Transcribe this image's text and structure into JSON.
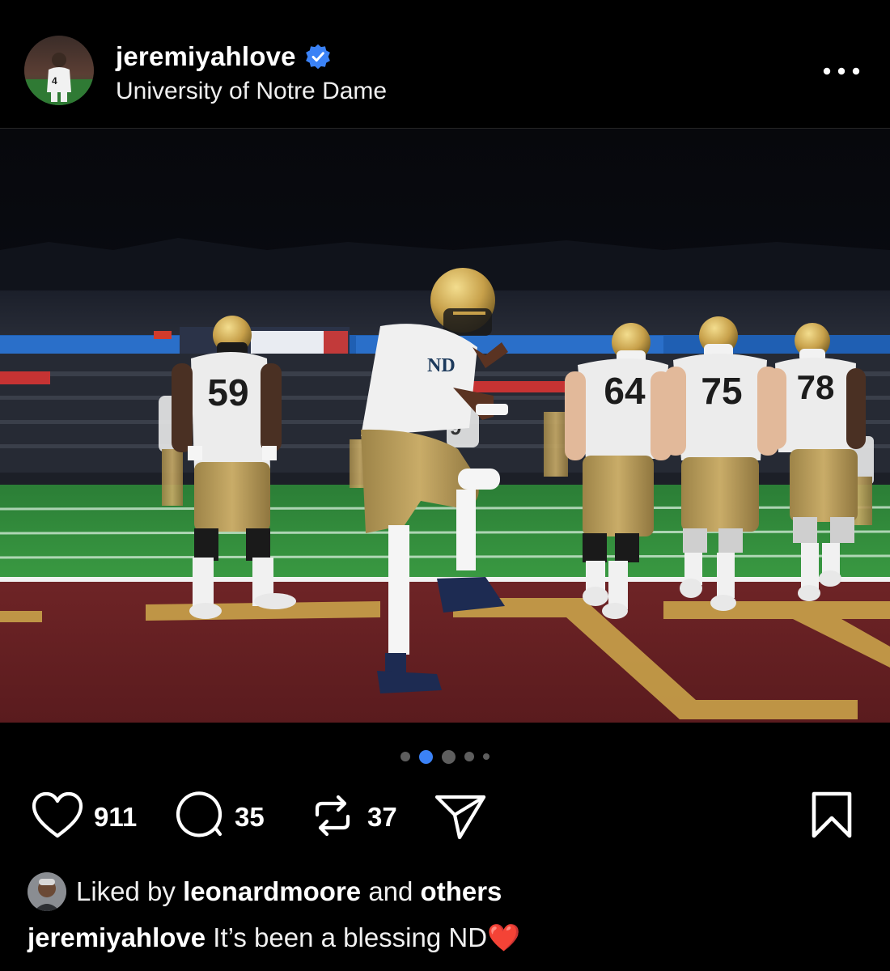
{
  "post": {
    "author": {
      "username": "jeremiyahlove",
      "verified": true,
      "location": "University of Notre Dame"
    },
    "media": {
      "jerseys": [
        "59",
        "64",
        "75",
        "78"
      ],
      "carousel": {
        "total": 5,
        "active_index": 1
      }
    },
    "actions": {
      "like_count": "911",
      "comment_count": "35",
      "repost_count": "37"
    },
    "likes": {
      "prefix": "Liked by",
      "user": "leonardmoore",
      "connector": "and",
      "others": "others"
    },
    "caption": {
      "username": "jeremiyahlove",
      "text": "It’s been a blessing ND",
      "emoji": "❤️"
    }
  },
  "colors": {
    "background": "#000000",
    "text": "#f5f5f5",
    "verified_badge": "#3b82f6",
    "active_dot": "#3b82f6",
    "inactive_dot": "#5e5e5e",
    "turf": "#2f8f3a",
    "endzone": "#6b1f22",
    "endzone_letter": "#c9a24a"
  },
  "icons": [
    "verified-badge-icon",
    "more-options-icon",
    "heart-icon",
    "comment-icon",
    "repost-icon",
    "share-icon",
    "bookmark-icon"
  ]
}
